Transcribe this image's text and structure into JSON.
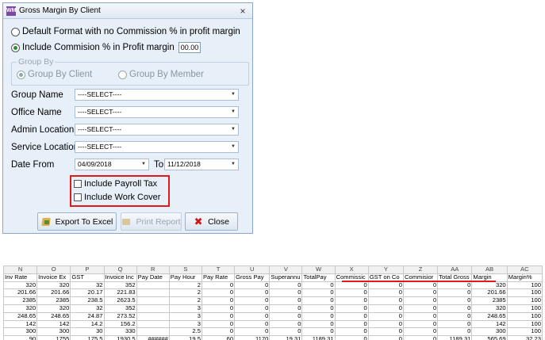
{
  "dialog": {
    "title": "Gross Margin By Client",
    "app_icon_text": "WM",
    "close_glyph": "×",
    "option_default": "Default Format with no Commission % in profit margin",
    "option_include": "Include Commision % in Profit margin",
    "commission_pct": "00.00",
    "group_by": {
      "legend": "Group By",
      "by_client": "Group By Client",
      "by_member": "Group By Member"
    },
    "fields": {
      "group_name_label": "Group Name",
      "group_name_value": "----SELECT----",
      "office_name_label": "Office Name",
      "office_name_value": "----SELECT----",
      "admin_location_label": "Admin Location",
      "admin_location_value": "----SELECT----",
      "service_location_label": "Service Location",
      "service_location_value": "----SELECT----",
      "date_from_label": "Date From",
      "date_from_value": "04/09/2018",
      "to_label": "To",
      "date_to_value": "11/12/2018"
    },
    "checks": {
      "payroll_tax": "Include Payroll Tax",
      "work_cover": "Include Work Cover"
    },
    "buttons": {
      "export": "Export To Excel",
      "print": "Print Report",
      "close": "Close"
    }
  },
  "spreadsheet": {
    "column_letters": [
      "N",
      "O",
      "P",
      "Q",
      "R",
      "S",
      "T",
      "U",
      "V",
      "W",
      "X",
      "Y",
      "Z",
      "AA",
      "AB",
      "AC"
    ],
    "headers": [
      "Inv Rate",
      "Invoice Ex",
      "GST",
      "Invoice Inc",
      "Pay Date",
      "Pay Hour",
      "Pay Rate",
      "Gross Pay",
      "Superannu",
      "TotalPay",
      "Commissic",
      "GST on Co",
      "Commisior",
      "Total Gross",
      "Margin",
      "Margin%"
    ],
    "rows": [
      [
        "320",
        "320",
        "32",
        "352",
        "",
        "2",
        "0",
        "0",
        "0",
        "0",
        "0",
        "0",
        "0",
        "0",
        "320",
        "100"
      ],
      [
        "201.66",
        "201.66",
        "20.17",
        "221.83",
        "",
        "2",
        "0",
        "0",
        "0",
        "0",
        "0",
        "0",
        "0",
        "0",
        "201.66",
        "100"
      ],
      [
        "2385",
        "2385",
        "238.5",
        "2623.5",
        "",
        "2",
        "0",
        "0",
        "0",
        "0",
        "0",
        "0",
        "0",
        "0",
        "2385",
        "100"
      ],
      [
        "320",
        "320",
        "32",
        "352",
        "",
        "3",
        "0",
        "0",
        "0",
        "0",
        "0",
        "0",
        "0",
        "0",
        "320",
        "100"
      ],
      [
        "248.65",
        "248.65",
        "24.87",
        "273.52",
        "",
        "3",
        "0",
        "0",
        "0",
        "0",
        "0",
        "0",
        "0",
        "0",
        "248.65",
        "100"
      ],
      [
        "142",
        "142",
        "14.2",
        "156.2",
        "",
        "3",
        "0",
        "0",
        "0",
        "0",
        "0",
        "0",
        "0",
        "0",
        "142",
        "100"
      ],
      [
        "300",
        "300",
        "30",
        "330",
        "",
        "2.5",
        "0",
        "0",
        "0",
        "0",
        "0",
        "0",
        "0",
        "0",
        "300",
        "100"
      ],
      [
        "90",
        "1755",
        "175.5",
        "1930.5",
        "######",
        "19.5",
        "60",
        "1170",
        "19.31",
        "1189.31",
        "0",
        "0",
        "0",
        "1189.31",
        "565.69",
        "32.23"
      ]
    ]
  }
}
